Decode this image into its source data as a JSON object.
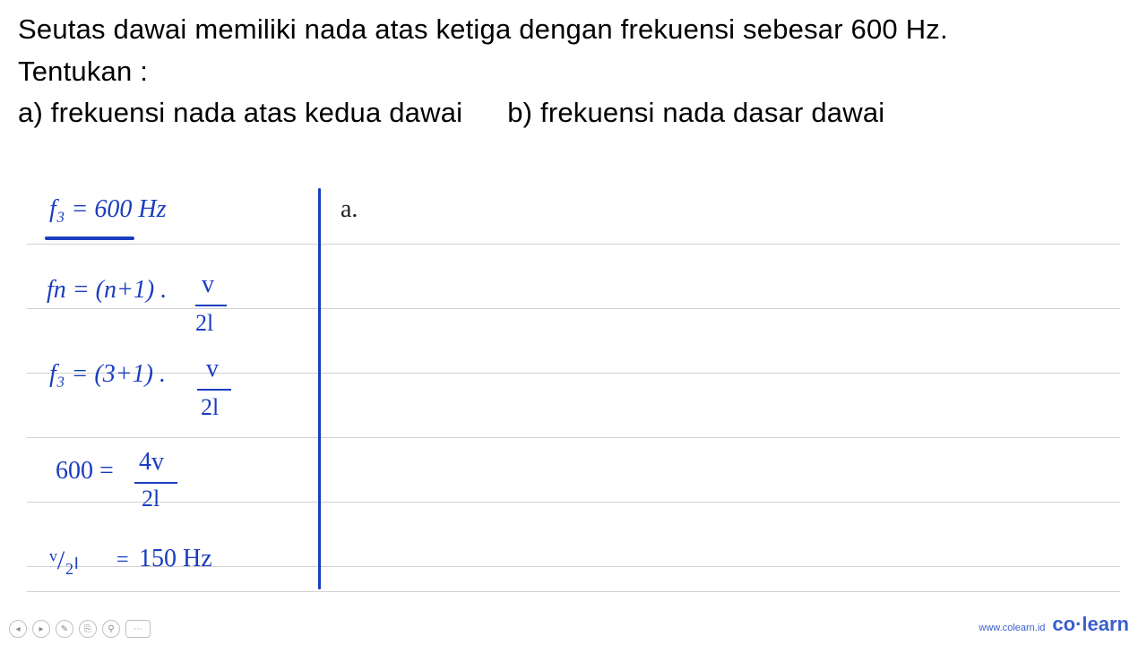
{
  "question": {
    "line1": "Seutas dawai memiliki nada atas ketiga dengan frekuensi sebesar 600 Hz.",
    "line2": "Tentukan :",
    "part_a": "a) frekuensi nada atas kedua dawai",
    "part_b": "b) frekuensi nada dasar dawai"
  },
  "handwriting": {
    "given": "f₃ = 600 Hz",
    "section_label": "a.",
    "formula_fn": "fn = (n+1) .",
    "formula_fn_num": "v",
    "formula_fn_den": "2l",
    "formula_f3": "f₃ = (3+1) .",
    "formula_f3_num": "v",
    "formula_f3_den": "2l",
    "calc_600": "600 =",
    "calc_600_num": "4v",
    "calc_600_den": "2l",
    "result_lhs": "ᵛ/₂ₗ",
    "result_eq": "=",
    "result_val": "150 Hz"
  },
  "brand": {
    "url": "www.colearn.id",
    "name": "co·learn"
  }
}
